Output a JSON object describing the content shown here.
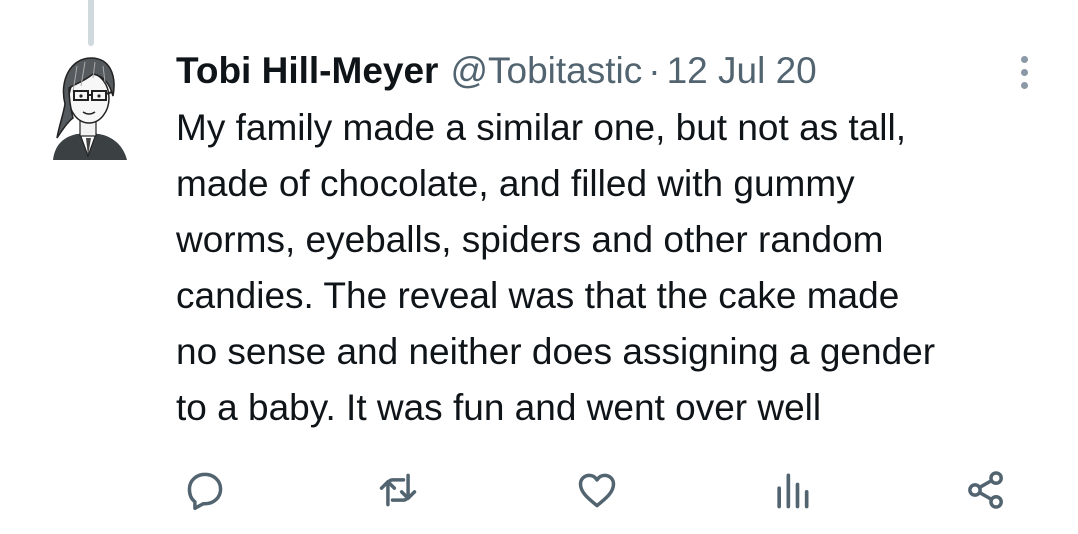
{
  "tweet": {
    "author": {
      "display_name": "Tobi Hill-Meyer",
      "handle": "@Tobitastic"
    },
    "separator": "·",
    "date": "12 Jul 20",
    "lines": [
      "My family made a similar one, but not as tall,",
      "made of chocolate, and filled with gummy",
      "worms, eyeballs, spiders and other random",
      "candies. The reveal was that the cake made",
      "no sense and neither does assigning a gender",
      "to a baby. It was fun and went over well"
    ]
  },
  "icons": {
    "avatar": "cartoon-portrait-avatar",
    "more": "more-vertical-icon",
    "reply": "reply-icon",
    "retweet": "retweet-icon",
    "like": "like-icon",
    "views": "views-icon",
    "share": "share-icon"
  },
  "colors": {
    "text": "#0f1419",
    "secondary_text": "#536471",
    "thread_line": "#cfd9de",
    "icon": "#536471"
  }
}
